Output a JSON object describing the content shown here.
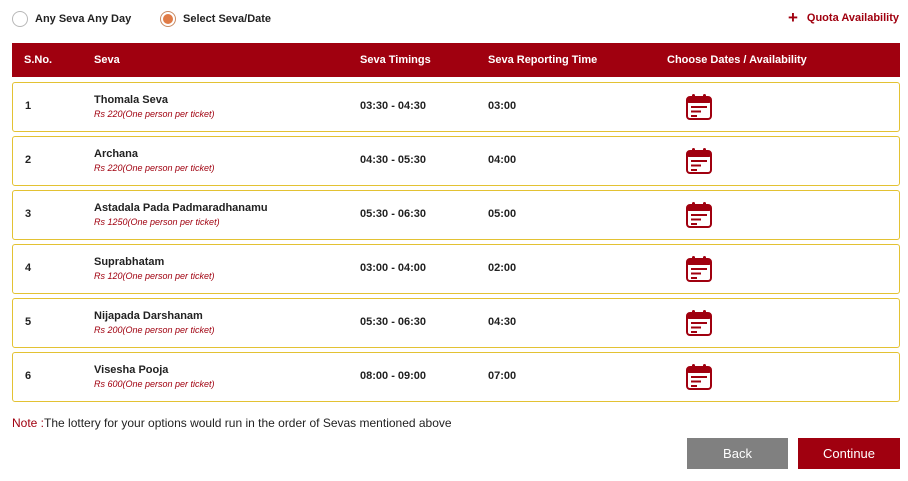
{
  "options": {
    "any_seva": {
      "label": "Any Seva Any Day",
      "selected": false
    },
    "select_seva": {
      "label": "Select Seva/Date",
      "selected": true
    }
  },
  "quota": {
    "plus": "+",
    "label": "Quota Availability"
  },
  "table": {
    "headers": {
      "sno": "S.No.",
      "seva": "Seva",
      "timings": "Seva Timings",
      "reporting": "Seva Reporting Time",
      "dates": "Choose Dates / Availability"
    },
    "rows": [
      {
        "sno": "1",
        "name": "Thomala Seva",
        "price": "Rs 220(One person per ticket)",
        "timing": "03:30 - 04:30",
        "report": "03:00",
        "icon": "calendar-icon"
      },
      {
        "sno": "2",
        "name": "Archana",
        "price": "Rs 220(One person per ticket)",
        "timing": "04:30 - 05:30",
        "report": "04:00",
        "icon": "calendar-icon"
      },
      {
        "sno": "3",
        "name": "Astadala Pada Padmaradhanamu",
        "price": "Rs 1250(One person per ticket)",
        "timing": "05:30 - 06:30",
        "report": "05:00",
        "icon": "calendar-icon"
      },
      {
        "sno": "4",
        "name": "Suprabhatam",
        "price": "Rs 120(One person per ticket)",
        "timing": "03:00 - 04:00",
        "report": "02:00",
        "icon": "calendar-icon"
      },
      {
        "sno": "5",
        "name": "Nijapada Darshanam",
        "price": "Rs 200(One person per ticket)",
        "timing": "05:30 - 06:30",
        "report": "04:30",
        "icon": "calendar-icon"
      },
      {
        "sno": "6",
        "name": "Visesha Pooja",
        "price": "Rs 600(One person per ticket)",
        "timing": "08:00 - 09:00",
        "report": "07:00",
        "icon": "calendar-icon"
      }
    ]
  },
  "note": {
    "label": "Note :",
    "text": "The lottery for your options would run in the order of Sevas mentioned above"
  },
  "buttons": {
    "back": "Back",
    "continue": "Continue"
  },
  "colors": {
    "brand": "#a0000f",
    "row_border": "#e3c233",
    "radio_selected": "#e07b46",
    "back_button": "#808080"
  }
}
